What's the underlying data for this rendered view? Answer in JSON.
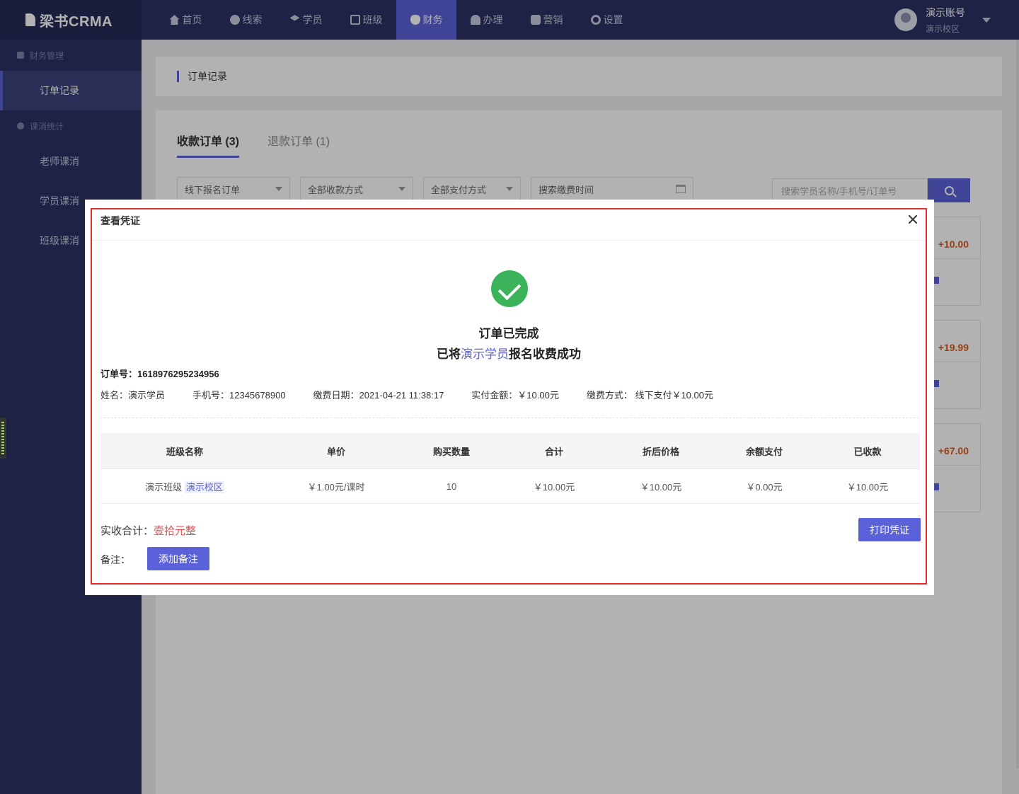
{
  "brand": {
    "logo_text": "梁书CRMA"
  },
  "nav": {
    "items": [
      {
        "label": "首页",
        "icon": "home-icon"
      },
      {
        "label": "线索",
        "icon": "clue-icon"
      },
      {
        "label": "学员",
        "icon": "student-icon"
      },
      {
        "label": "班级",
        "icon": "class-icon"
      },
      {
        "label": "财务",
        "icon": "finance-icon",
        "active": true
      },
      {
        "label": "办理",
        "icon": "handle-icon"
      },
      {
        "label": "营销",
        "icon": "marketing-icon"
      },
      {
        "label": "设置",
        "icon": "settings-icon"
      }
    ]
  },
  "user": {
    "name": "演示账号",
    "campus": "演示校区"
  },
  "sidebar": {
    "group1": "财务管理",
    "item_orders": "订单记录",
    "group2": "课消统计",
    "item_teacher": "老师课消",
    "item_student": "学员课消",
    "item_class": "班级课消"
  },
  "page": {
    "breadcrumb": "订单记录",
    "tab_income": "收款订单 (3)",
    "tab_refund": "退款订单 (1)",
    "filter_order_type": "线下报名订单",
    "filter_collect_method": "全部收款方式",
    "filter_pay_method": "全部支付方式",
    "filter_date_placeholder": "搜索缴费时间",
    "search_placeholder": "搜索学员名称/手机号/订单号",
    "order_amounts": [
      "+10.00",
      "+19.99",
      "+67.00"
    ]
  },
  "modal": {
    "title": "查看凭证",
    "done_title": "订单已完成",
    "done_prefix": "已将",
    "done_student": "演示学员",
    "done_suffix": "报名收费成功",
    "order_no": "订单号：1618976295234956",
    "info": {
      "name": "姓名：演示学员",
      "phone": "手机号：12345678900",
      "pay_date": "缴费日期：2021-04-21 11:38:17",
      "paid_amount": "实付金额：￥10.00元",
      "pay_method": "缴费方式：  线下支付￥10.00元"
    },
    "table": {
      "headers": [
        "班级名称",
        "单价",
        "购买数量",
        "合计",
        "折后价格",
        "余额支付",
        "已收款"
      ],
      "row": {
        "class_name": "演示班级",
        "campus": "演示校区",
        "unit_price": "￥1.00元/课时",
        "quantity": "10",
        "total": "￥10.00元",
        "discounted": "￥10.00元",
        "balance_pay": "￥0.00元",
        "received": "￥10.00元"
      }
    },
    "total_label": "实收合计：",
    "total_value": "壹拾元整",
    "print_label": "打印凭证",
    "remark_label": "备注：",
    "add_remark_label": "添加备注"
  },
  "colors": {
    "nav_bg": "#2b3263",
    "accent": "#5b62d9",
    "success": "#3bb35a",
    "amount": "#e05a1a",
    "highlight_border": "#e62b2b"
  }
}
